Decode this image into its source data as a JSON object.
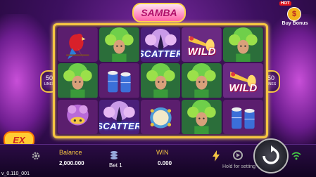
{
  "game": {
    "title": "SAMBA",
    "version": "v_0.110_001"
  },
  "side": {
    "lines_left": "50",
    "lines_right": "50",
    "lines_unit": "LINES"
  },
  "buy": {
    "hot": "HOT",
    "label": "Buy Bonus",
    "coin": "$"
  },
  "badge": {
    "label": "EX"
  },
  "bottom": {
    "balance_label": "Balance",
    "balance": "2,000.000",
    "bet_label": "Bet 1",
    "win_label": "WIN",
    "win": "0.000",
    "hold": "Hold for setting"
  },
  "reels": [
    [
      "parrot",
      "dancer",
      "scatter_dancer",
      "wild_trumpet",
      "dancer"
    ],
    [
      "dancer",
      "drums",
      "dancer",
      "dancer",
      "wild_trumpet"
    ],
    [
      "crown_mask",
      "scatter_dancer",
      "tambourine",
      "dancer",
      "drums"
    ]
  ],
  "symbols": {
    "scatter": "SCATTER",
    "wild": "WILD"
  },
  "icons": {
    "settings": "gear-icon",
    "bet": "coins-icon",
    "turbo": "lightning-icon",
    "auto": "auto-spin-icon",
    "spin": "spin-icon",
    "wifi": "wifi-icon"
  },
  "colors": {
    "frame": "#f5c542",
    "accent": "#f5c542",
    "bg": "#2a0b3e"
  }
}
